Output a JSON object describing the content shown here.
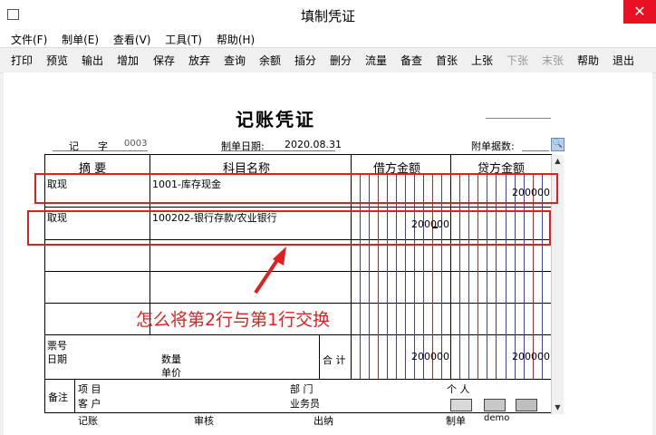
{
  "window": {
    "title": "填制凭证",
    "close_glyph": "✕"
  },
  "menu": [
    "文件(F)",
    "制单(E)",
    "查看(V)",
    "工具(T)",
    "帮助(H)"
  ],
  "toolbar": [
    {
      "label": "打印",
      "enabled": true
    },
    {
      "label": "预览",
      "enabled": true
    },
    {
      "label": "输出",
      "enabled": true
    },
    {
      "label": "增加",
      "enabled": true
    },
    {
      "label": "保存",
      "enabled": true
    },
    {
      "label": "放弃",
      "enabled": true
    },
    {
      "label": "查询",
      "enabled": true
    },
    {
      "label": "余额",
      "enabled": true
    },
    {
      "label": "插分",
      "enabled": true
    },
    {
      "label": "删分",
      "enabled": true
    },
    {
      "label": "流量",
      "enabled": true
    },
    {
      "label": "备查",
      "enabled": true
    },
    {
      "label": "首张",
      "enabled": true
    },
    {
      "label": "上张",
      "enabled": true
    },
    {
      "label": "下张",
      "enabled": false
    },
    {
      "label": "末张",
      "enabled": false
    },
    {
      "label": "帮助",
      "enabled": true
    },
    {
      "label": "退出",
      "enabled": true
    }
  ],
  "voucher": {
    "title": "记账凭证",
    "type_label": "记",
    "word_label": "字",
    "number": "0003",
    "date_label": "制单日期:",
    "date": "2020.08.31",
    "attach_label": "附单据数:",
    "attach_value": ""
  },
  "columns": {
    "summary": "摘 要",
    "account": "科目名称",
    "debit": "借方金额",
    "credit": "贷方金额"
  },
  "rows": [
    {
      "summary": "取现",
      "account": "1001-库存现金",
      "debit": "",
      "credit": "200000"
    },
    {
      "summary": "取现",
      "account": "100202-银行存款/农业银行",
      "debit": "200000",
      "credit": ""
    },
    {
      "summary": "",
      "account": "",
      "debit": "",
      "credit": ""
    },
    {
      "summary": "",
      "account": "",
      "debit": "",
      "credit": ""
    }
  ],
  "info": {
    "ticket_label": "票号",
    "date_label": "日期",
    "quantity_label": "数量",
    "price_label": "单价",
    "total_label": "合 计",
    "total_debit": "200000",
    "total_credit": "200000"
  },
  "remarks": {
    "label": "备注",
    "project_label": "项 目",
    "dept_label": "部 门",
    "person_label": "个 人",
    "customer_label": "客 户",
    "salesman_label": "业务员"
  },
  "footer": {
    "bookkeeping": "记账",
    "audit": "审核",
    "cashier": "出纳",
    "maker_label": "制单",
    "maker": "demo"
  },
  "annotation": "怎么将第2行与第1行交换",
  "colors": {
    "annotation": "#e02020",
    "close_button": "#e81123",
    "blue_line": "#3b3bd1",
    "red_line": "#d42020"
  }
}
